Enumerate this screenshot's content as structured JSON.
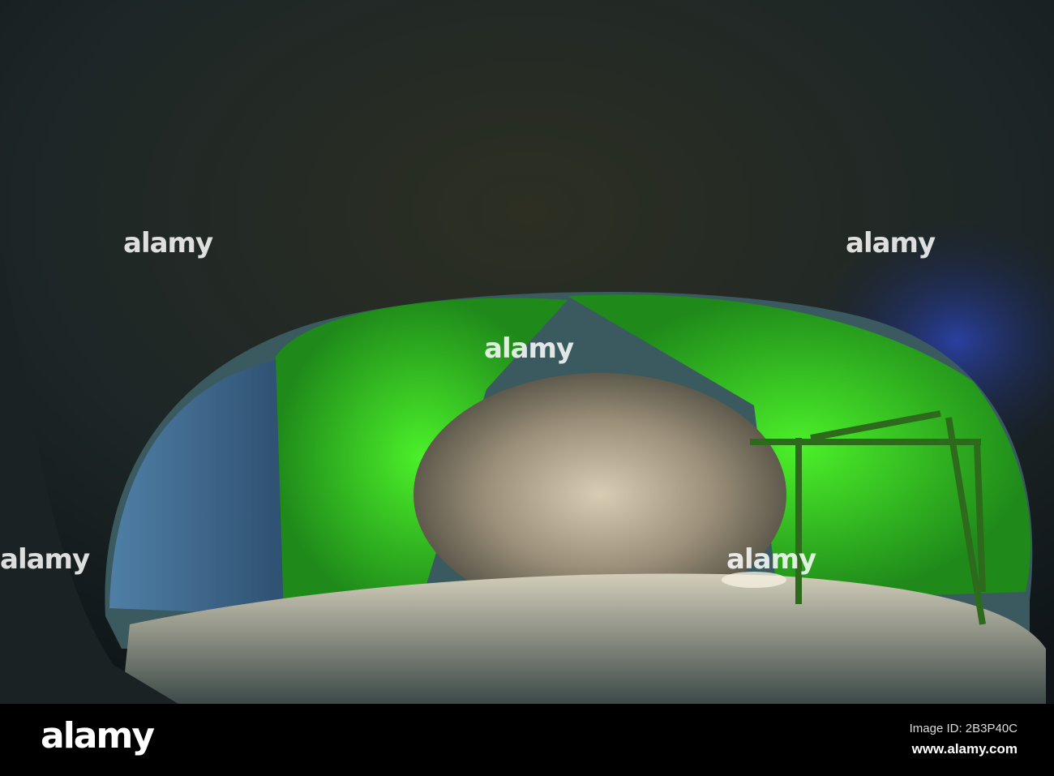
{
  "watermark": {
    "text": "alamy"
  },
  "footer": {
    "logo": "alamy",
    "image_id": "Image ID: 2B3P40C",
    "url": "www.alamy.com"
  }
}
